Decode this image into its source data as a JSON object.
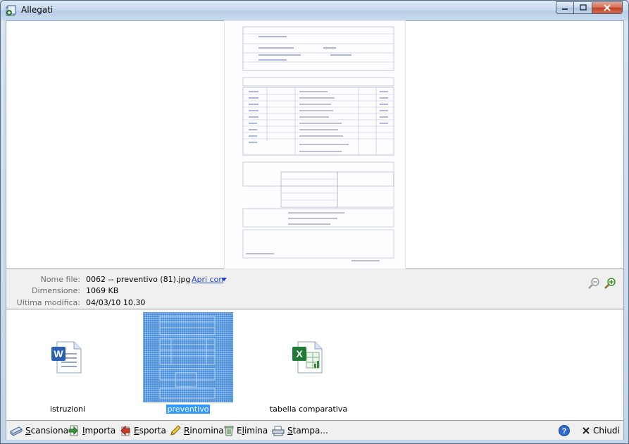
{
  "window": {
    "title": "Allegati"
  },
  "file_info": {
    "name_label": "Nome file:",
    "name_value": "0062 -- preventivo (81).jpg",
    "open_with_label": "Apri con",
    "size_label": "Dimensione:",
    "size_value": "1069 KB",
    "modified_label": "Ultima modifica:",
    "modified_value": "04/03/10 10.30"
  },
  "attachments": [
    {
      "label": "istruzioni",
      "icon": "word-document-icon",
      "selected": false
    },
    {
      "label": "preventivo",
      "icon": "image-thumbnail",
      "selected": true
    },
    {
      "label": "tabella comparativa",
      "icon": "excel-spreadsheet-icon",
      "selected": false
    }
  ],
  "toolbar": {
    "scan": {
      "accel": "S",
      "rest": "cansiona"
    },
    "import": {
      "accel": "I",
      "rest": "mporta"
    },
    "export": {
      "accel": "E",
      "rest": "sporta"
    },
    "rename": {
      "accel": "R",
      "rest": "inomina"
    },
    "delete_pre": "E",
    "delete_accel": "l",
    "delete_rest": "imina",
    "print": {
      "accel": "S",
      "rest": "tampa..."
    },
    "close": "Chiudi"
  },
  "colors": {
    "selection": "#3399ff",
    "link": "#1a3fd1"
  }
}
